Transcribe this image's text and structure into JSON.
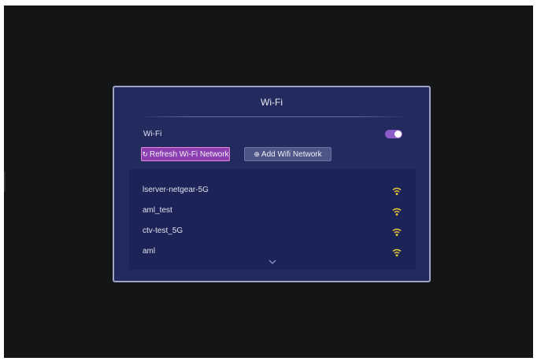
{
  "dialog": {
    "title": "Wi-Fi",
    "wifi_label": "Wi-Fi",
    "wifi_enabled": true,
    "refresh_button": {
      "icon": "refresh-icon",
      "glyph": "↻",
      "label": "Refresh Wi-Fi Network"
    },
    "add_button": {
      "icon": "add-circle-icon",
      "glyph": "⊕",
      "label": "Add Wifi Network"
    },
    "networks": [
      {
        "name": "lserver-netgear-5G",
        "icon": "wifi-signal-icon"
      },
      {
        "name": "aml_test",
        "icon": "wifi-signal-icon"
      },
      {
        "name": "ctv-test_5G",
        "icon": "wifi-signal-icon"
      },
      {
        "name": "aml",
        "icon": "wifi-signal-icon"
      }
    ],
    "more_indicator": "chevron-down-icon"
  },
  "colors": {
    "screen_bg": "#141516",
    "dialog_bg": "#222a5e",
    "panel_bg": "#1c2457",
    "accent_purple": "#8c3fb0",
    "toggle_on": "#8c5cc9",
    "signal_yellow": "#e0c23a"
  }
}
